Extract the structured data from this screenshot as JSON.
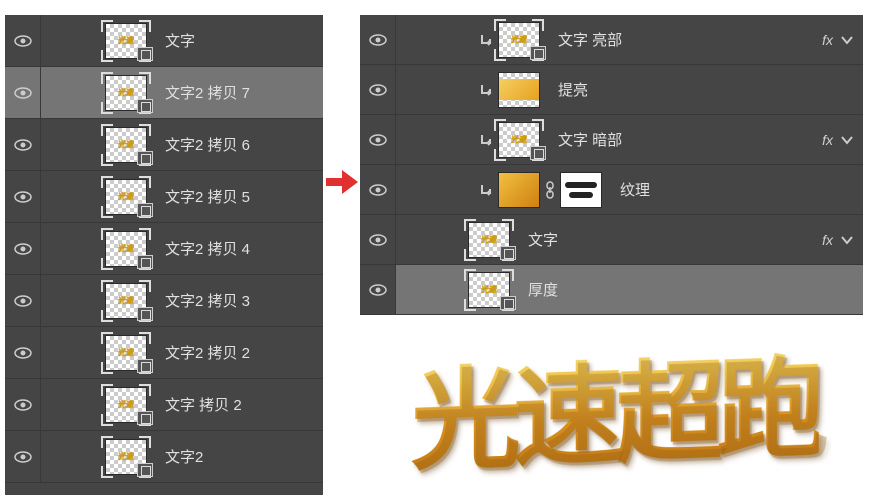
{
  "leftPanel": {
    "layers": [
      {
        "name": "文字",
        "selected": false
      },
      {
        "name": "文字2 拷贝 7",
        "selected": true
      },
      {
        "name": "文字2 拷贝 6",
        "selected": false
      },
      {
        "name": "文字2 拷贝 5",
        "selected": false
      },
      {
        "name": "文字2 拷贝 4",
        "selected": false
      },
      {
        "name": "文字2 拷贝 3",
        "selected": false
      },
      {
        "name": "文字2 拷贝 2",
        "selected": false
      },
      {
        "name": "文字 拷贝 2",
        "selected": false
      },
      {
        "name": "文字2",
        "selected": false
      }
    ]
  },
  "rightPanel": {
    "layers": [
      {
        "name": "文字 亮部",
        "clipped": true,
        "fx": true,
        "thumbStyle": "text"
      },
      {
        "name": "提亮",
        "clipped": true,
        "fx": false,
        "thumbStyle": "gold"
      },
      {
        "name": "文字 暗部",
        "clipped": true,
        "fx": true,
        "thumbStyle": "text"
      },
      {
        "name": "纹理",
        "clipped": true,
        "fx": false,
        "thumbStyle": "texture",
        "hasMask": true
      },
      {
        "name": "文字",
        "clipped": false,
        "fx": true,
        "thumbStyle": "text"
      },
      {
        "name": "厚度",
        "clipped": false,
        "fx": false,
        "thumbStyle": "text",
        "selected": true
      }
    ]
  },
  "fxLabel": "fx",
  "artworkText": "光速超跑"
}
